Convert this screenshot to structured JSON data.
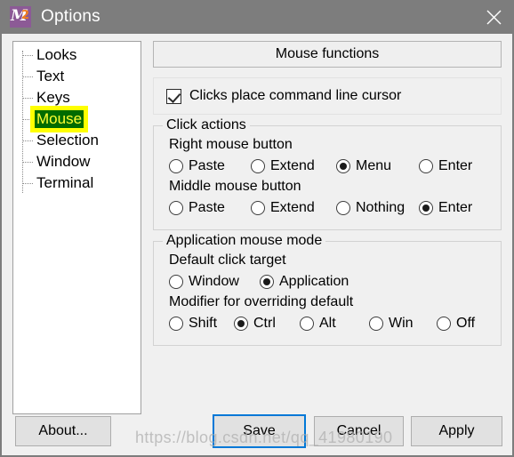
{
  "window": {
    "title": "Options",
    "icon": "mobaxterm-logo-icon",
    "icon_letter": "M",
    "icon_digit": "2",
    "close_label": "✕",
    "titlebar_color": "#7d7d7d",
    "background_color": "#f0f0f0",
    "accent_color": "#0078d7"
  },
  "sidebar": {
    "items": [
      {
        "label": "Looks",
        "selected": false
      },
      {
        "label": "Text",
        "selected": false
      },
      {
        "label": "Keys",
        "selected": false
      },
      {
        "label": "Mouse",
        "selected": true
      },
      {
        "label": "Selection",
        "selected": false
      },
      {
        "label": "Window",
        "selected": false
      },
      {
        "label": "Terminal",
        "selected": false
      }
    ],
    "selected_highlight_bg": "#006b00",
    "selected_highlight_outline": "#ffff00"
  },
  "main": {
    "section_button": "Mouse functions",
    "checkbox": {
      "label": "Clicks place command line cursor",
      "checked": true
    },
    "click_actions": {
      "title": "Click actions",
      "right_mouse": {
        "label": "Right mouse button",
        "options": [
          {
            "label": "Paste",
            "selected": false
          },
          {
            "label": "Extend",
            "selected": false
          },
          {
            "label": "Menu",
            "selected": true
          },
          {
            "label": "Enter",
            "selected": false
          }
        ]
      },
      "middle_mouse": {
        "label": "Middle mouse button",
        "options": [
          {
            "label": "Paste",
            "selected": false
          },
          {
            "label": "Extend",
            "selected": false
          },
          {
            "label": "Nothing",
            "selected": false
          },
          {
            "label": "Enter",
            "selected": true
          }
        ]
      }
    },
    "application_mouse_mode": {
      "title": "Application mouse mode",
      "default_click_target": {
        "label": "Default click target",
        "options": [
          {
            "label": "Window",
            "selected": false
          },
          {
            "label": "Application",
            "selected": true
          }
        ]
      },
      "modifier": {
        "label": "Modifier for overriding default",
        "options": [
          {
            "label": "Shift",
            "selected": false
          },
          {
            "label": "Ctrl",
            "selected": true
          },
          {
            "label": "Alt",
            "selected": false
          },
          {
            "label": "Win",
            "selected": false
          },
          {
            "label": "Off",
            "selected": false
          }
        ]
      }
    }
  },
  "footer": {
    "about": "About...",
    "save": "Save",
    "cancel": "Cancel",
    "apply": "Apply"
  },
  "watermark": {
    "text": "https://blog.csdn.net/qq_41980190"
  }
}
